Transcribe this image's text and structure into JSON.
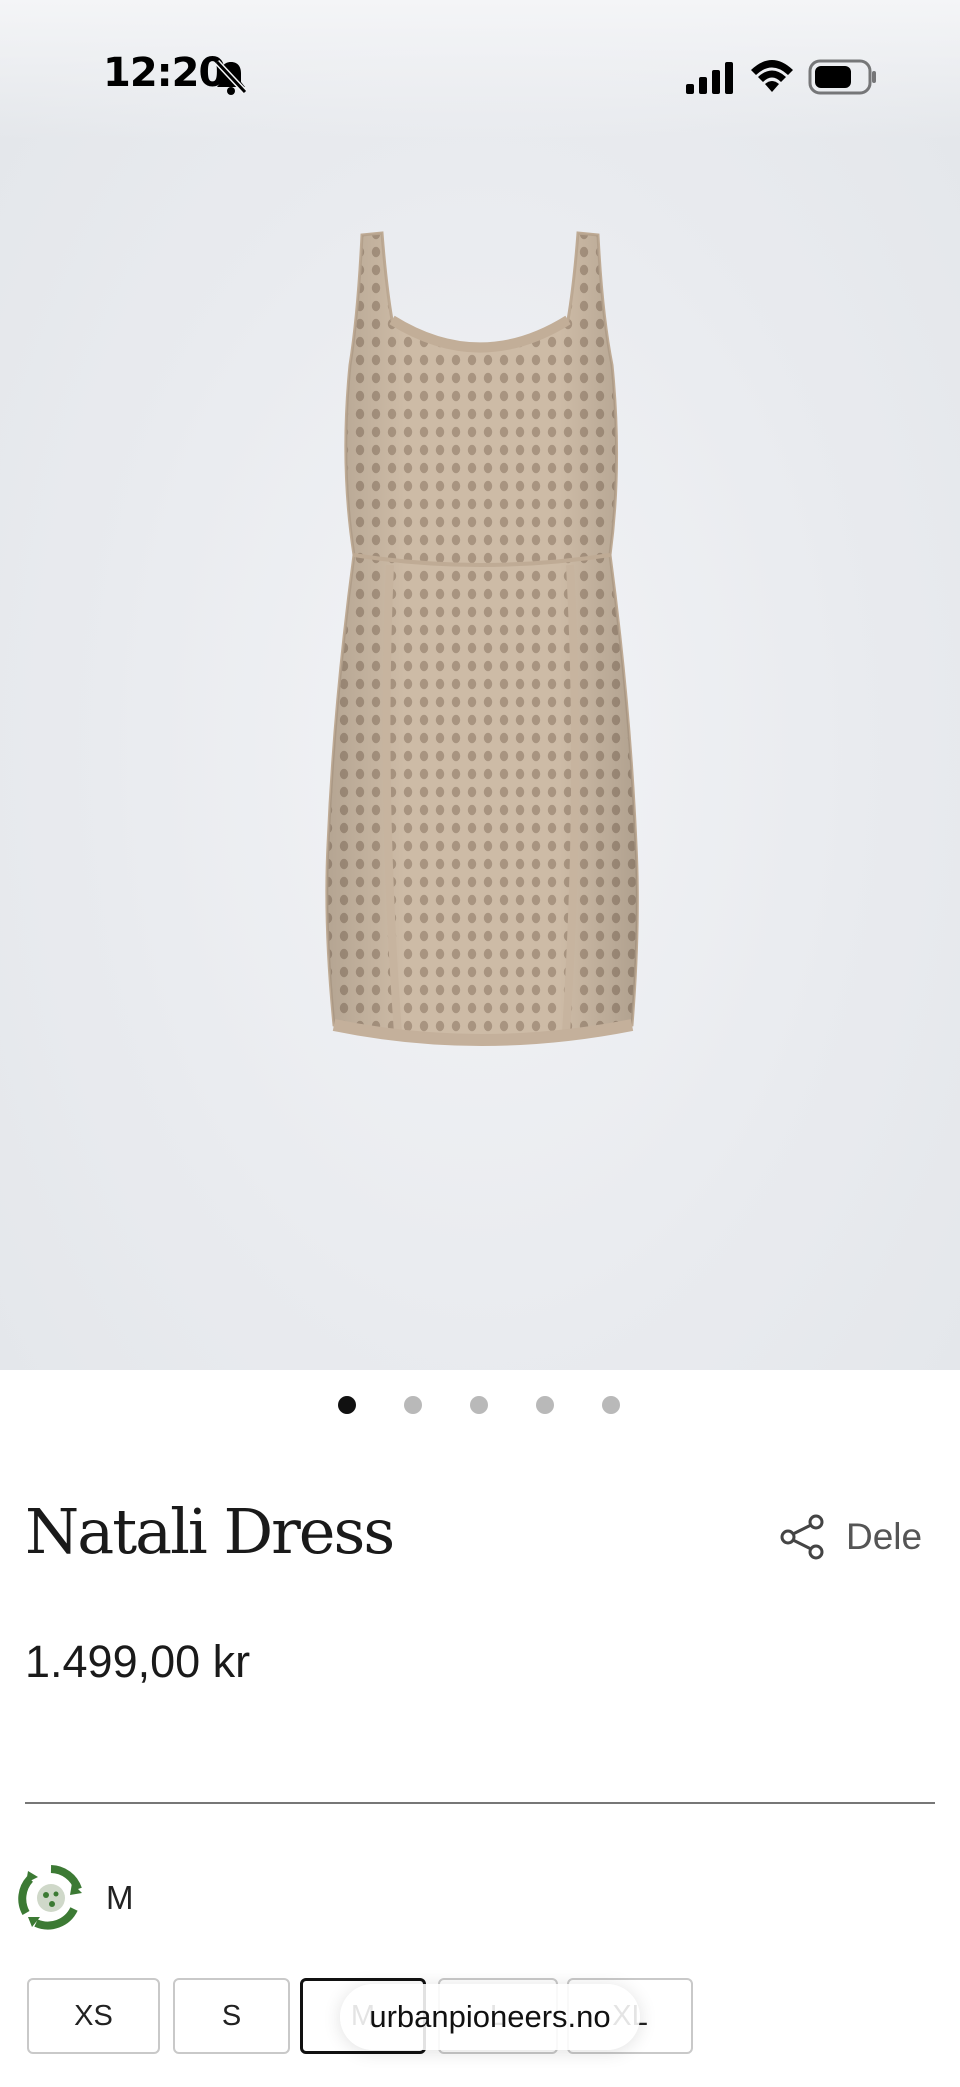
{
  "status_bar": {
    "time": "12:20",
    "icons": [
      "bell-slash-icon",
      "cellular-signal-icon",
      "wifi-icon",
      "battery-icon"
    ]
  },
  "product": {
    "title": "Natali Dress",
    "price": "1.499,00 kr",
    "share_label": "Dele",
    "image_count": 5,
    "active_image_index": 0,
    "color": "#c9b7a3"
  },
  "fit": {
    "label": "M"
  },
  "sizes": [
    {
      "label": "XS",
      "selected": false
    },
    {
      "label": "S",
      "selected": false
    },
    {
      "label": "M",
      "selected": true
    },
    {
      "label": "L",
      "selected": false
    },
    {
      "label": "XL",
      "selected": false
    }
  ],
  "browser": {
    "url": "urbanpioneers.no"
  }
}
